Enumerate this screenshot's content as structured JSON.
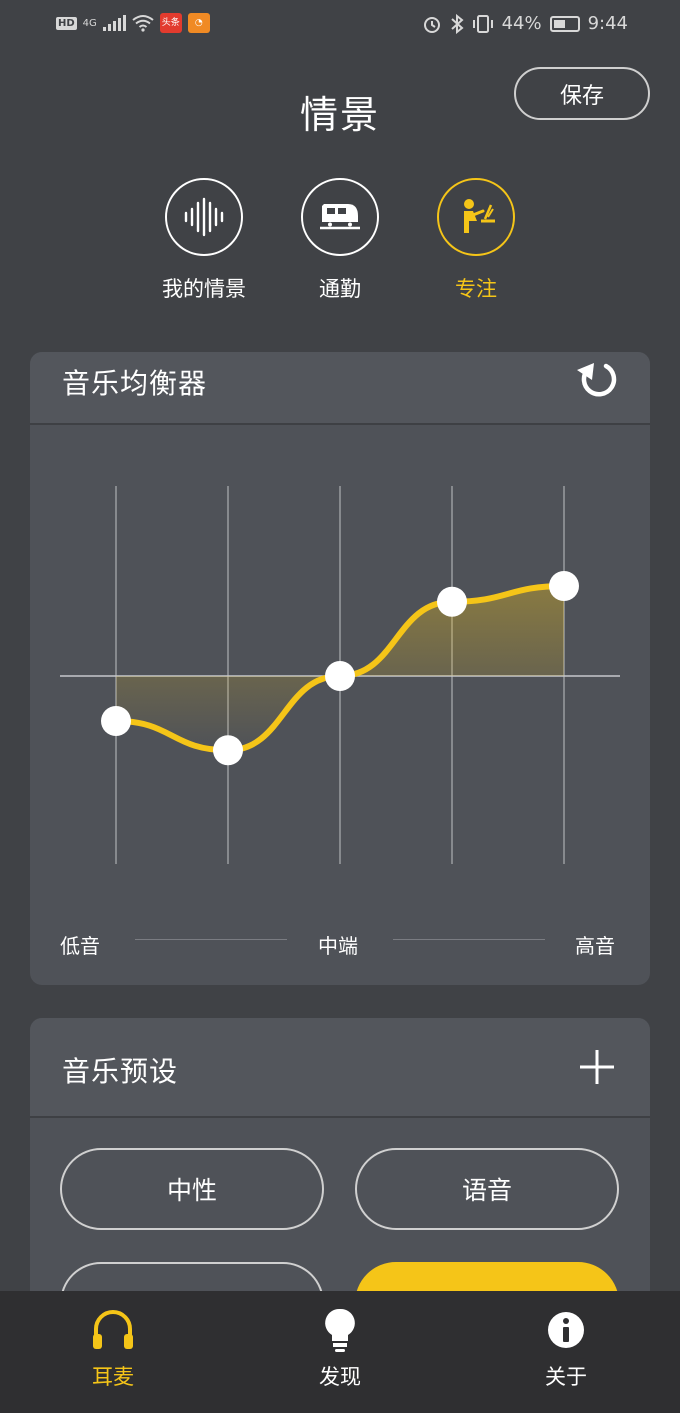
{
  "status_bar": {
    "hd": "HD",
    "network": "4G",
    "app_badge_1": "头条",
    "battery_percent": "44%",
    "time": "9:44"
  },
  "header": {
    "title": "情景",
    "save_label": "保存"
  },
  "modes": [
    {
      "label": "我的情景",
      "icon": "waveform-icon",
      "active": false
    },
    {
      "label": "通勤",
      "icon": "train-icon",
      "active": false
    },
    {
      "label": "专注",
      "icon": "focus-desk-icon",
      "active": true
    }
  ],
  "equalizer": {
    "title": "音乐均衡器",
    "reset_icon": "reset-icon",
    "bands": [
      {
        "level": -0.2
      },
      {
        "level": -0.33
      },
      {
        "level": 0.0
      },
      {
        "level": 0.33
      },
      {
        "level": 0.4
      }
    ],
    "labels": {
      "low": "低音",
      "mid": "中端",
      "high": "高音"
    }
  },
  "presets": {
    "title": "音乐预设",
    "add_icon": "plus-icon",
    "items": [
      {
        "label": "中性",
        "active": false
      },
      {
        "label": "语音",
        "active": false
      },
      {
        "label": "",
        "active": false
      },
      {
        "label": "",
        "active": true
      }
    ]
  },
  "bottom_nav": [
    {
      "label": "耳麦",
      "icon": "headphones-icon",
      "active": true
    },
    {
      "label": "发现",
      "icon": "lightbulb-icon",
      "active": false
    },
    {
      "label": "关于",
      "icon": "info-icon",
      "active": false
    }
  ],
  "colors": {
    "accent": "#f5c518",
    "background": "#404246",
    "card": "#4f5258",
    "nav_background": "#2f2f31"
  }
}
